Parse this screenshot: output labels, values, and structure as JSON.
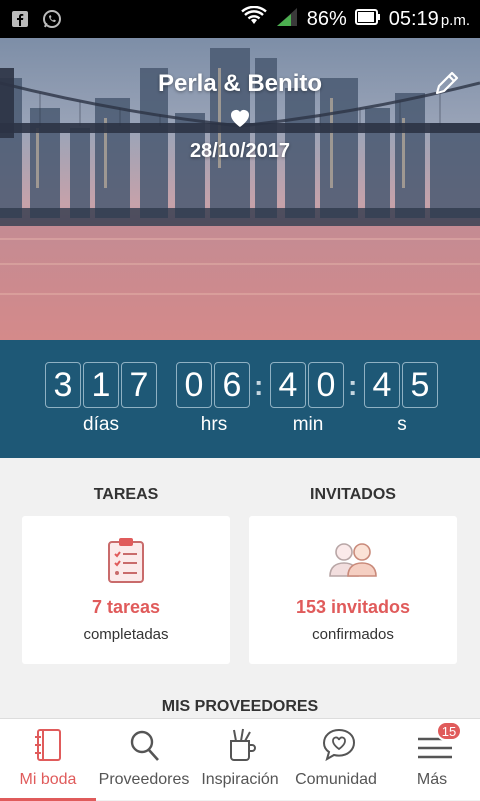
{
  "status_bar": {
    "battery": "86%",
    "time": "05:19",
    "ampm": "p.m."
  },
  "hero": {
    "couple": "Perla & Benito",
    "date": "28/10/2017"
  },
  "countdown": {
    "days": [
      "3",
      "1",
      "7"
    ],
    "hours": [
      "0",
      "6"
    ],
    "minutes": [
      "4",
      "0"
    ],
    "seconds": [
      "4",
      "5"
    ],
    "labels": {
      "days": "días",
      "hours": "hrs",
      "minutes": "min",
      "seconds": "s"
    }
  },
  "tareas": {
    "title": "TAREAS",
    "main": "7 tareas",
    "sub": "completadas"
  },
  "invitados": {
    "title": "INVITADOS",
    "main": "153 invitados",
    "sub": "confirmados"
  },
  "mis_proveedores": "MIS PROVEEDORES",
  "bottom_nav": {
    "items": [
      {
        "label": "Mi boda",
        "icon": "notebook-icon",
        "active": true
      },
      {
        "label": "Proveedores",
        "icon": "search-icon"
      },
      {
        "label": "Inspiración",
        "icon": "inspiration-icon"
      },
      {
        "label": "Comunidad",
        "icon": "chat-heart-icon"
      },
      {
        "label": "Más",
        "icon": "menu-icon",
        "badge": "15"
      }
    ]
  },
  "colors": {
    "accent": "#e05b5b",
    "countdown_bg": "#1e5876"
  }
}
